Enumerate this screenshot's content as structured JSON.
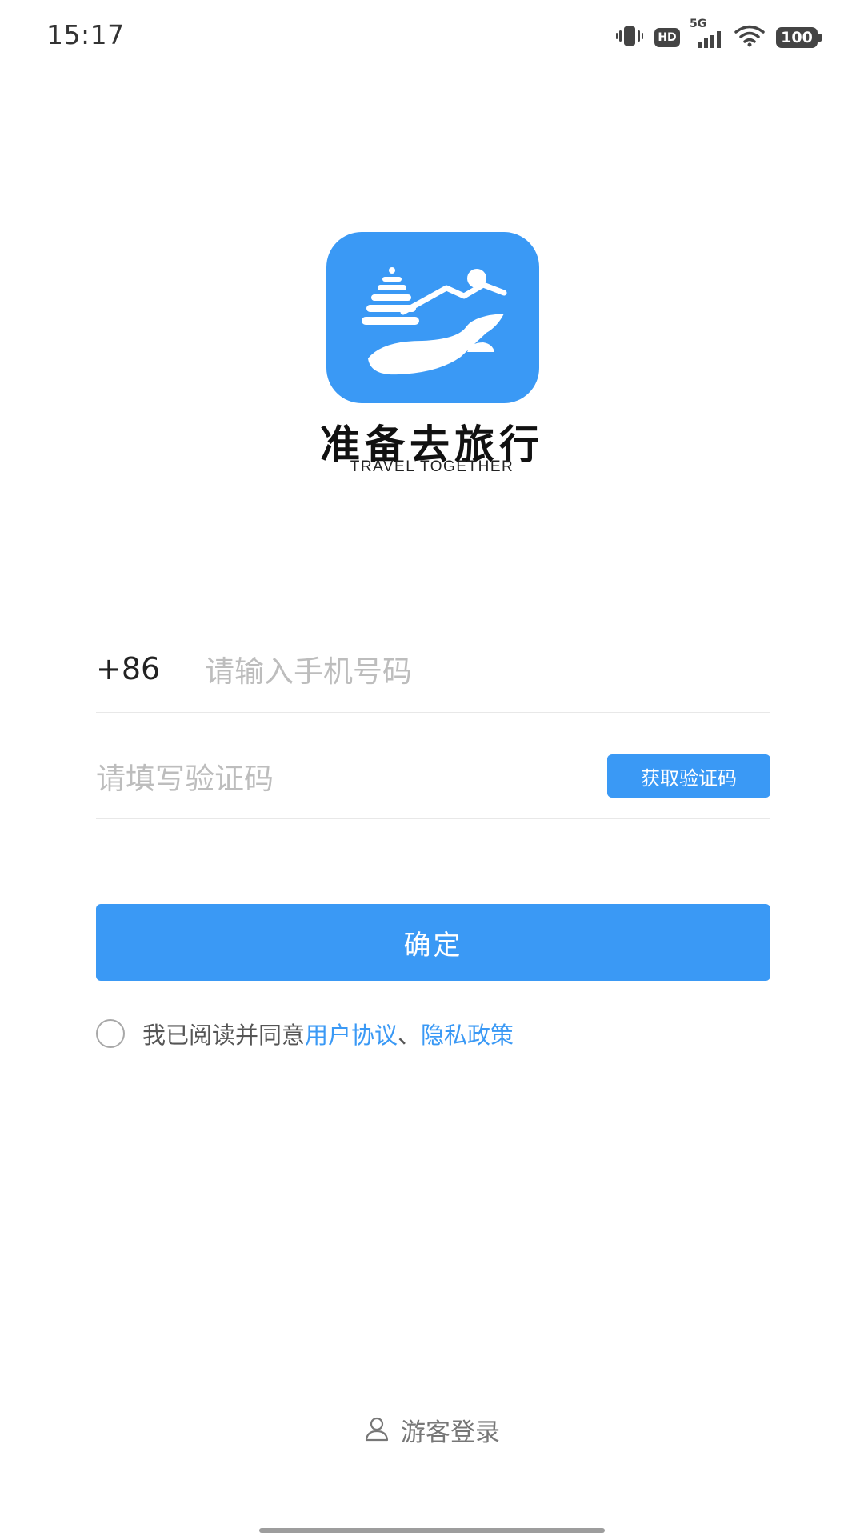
{
  "status_bar": {
    "time": "15:17",
    "network": "5G",
    "hd": "HD",
    "battery": "100",
    "icons": [
      "vibrate-icon",
      "hd-icon",
      "signal-5g-icon",
      "wifi-icon",
      "battery-icon"
    ]
  },
  "brand": {
    "name": "准备去旅行",
    "subtitle": "TRAVEL TOGETHER",
    "logo_color": "#3a99f5"
  },
  "login_form": {
    "country_code": "+86",
    "phone_placeholder": "请输入手机号码",
    "phone_value": "",
    "code_placeholder": "请填写验证码",
    "code_value": "",
    "get_code_label": "获取验证码",
    "confirm_label": "确定",
    "agree_prefix": "我已阅读并同意",
    "user_agreement_link": "用户协议",
    "separator": "、",
    "privacy_policy_link": "隐私政策",
    "agreed": false
  },
  "guest_login": {
    "label": "游客登录",
    "icon": "person-icon"
  },
  "colors": {
    "accent": "#3a99f5",
    "placeholder": "#bdbdbd",
    "divider": "#e8e8e8"
  }
}
